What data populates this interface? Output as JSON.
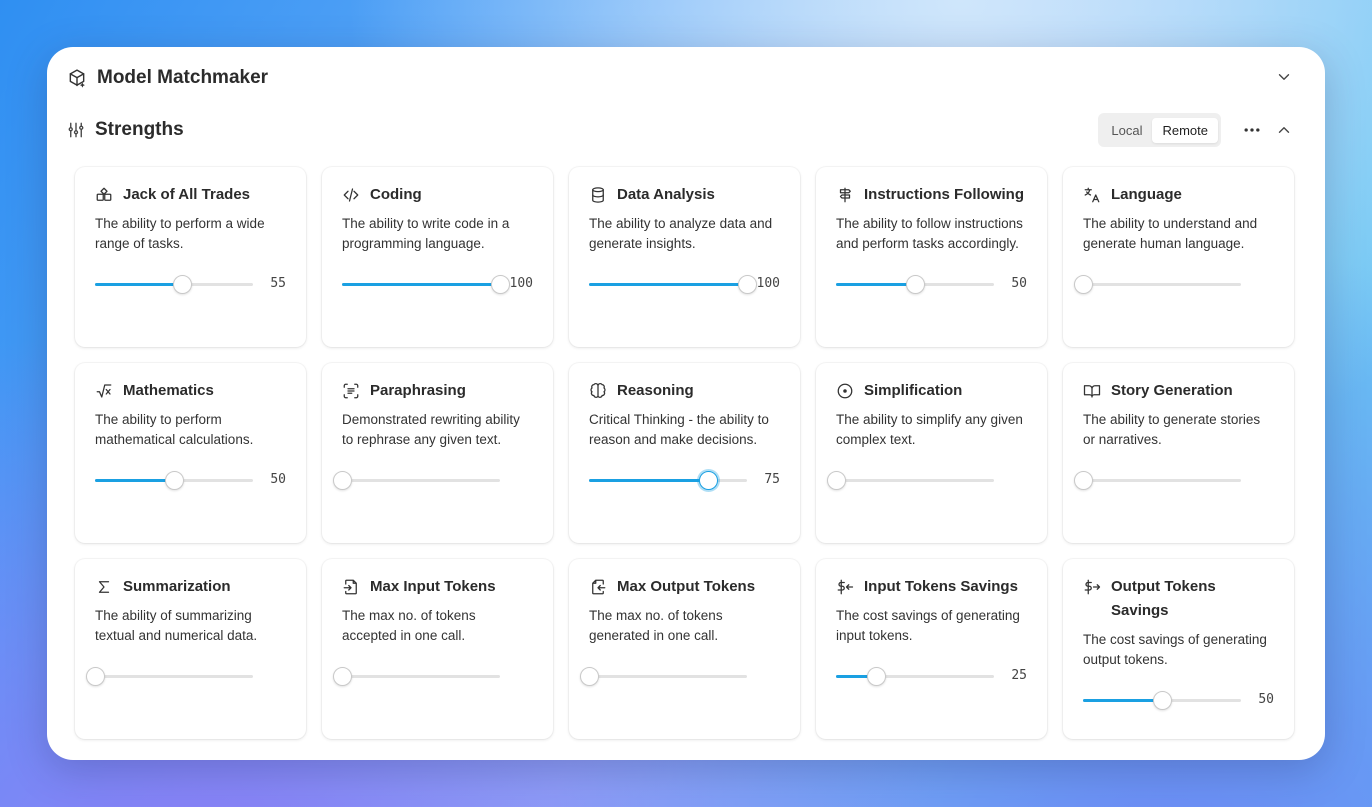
{
  "app": {
    "title": "Model Matchmaker"
  },
  "section": {
    "title": "Strengths",
    "toggle": {
      "local_label": "Local",
      "remote_label": "Remote",
      "active": "Remote"
    }
  },
  "colors": {
    "accent": "#1aa0e2",
    "track": "#e2e2e2"
  },
  "cards": [
    {
      "id": "jack-of-all-trades",
      "name": "Jack of All Trades",
      "icon": "shapes-icon",
      "desc": "The ability to perform a wide range of tasks.",
      "value": 55,
      "value_label": "55"
    },
    {
      "id": "coding",
      "name": "Coding",
      "icon": "code-icon",
      "desc": "The ability to write code in a programming language.",
      "value": 100,
      "value_label": "100"
    },
    {
      "id": "data-analysis",
      "name": "Data Analysis",
      "icon": "database-icon",
      "desc": "The ability to analyze data and generate insights.",
      "value": 100,
      "value_label": "100"
    },
    {
      "id": "instructions-following",
      "name": "Instructions Following",
      "icon": "signpost-icon",
      "desc": "The ability to follow instructions and perform tasks accordingly.",
      "value": 50,
      "value_label": "50"
    },
    {
      "id": "language",
      "name": "Language",
      "icon": "translate-icon",
      "desc": "The ability to understand and generate human language.",
      "value": 0,
      "value_label": ""
    },
    {
      "id": "mathematics",
      "name": "Mathematics",
      "icon": "square-root-icon",
      "desc": "The ability to perform mathematical calculations.",
      "value": 50,
      "value_label": "50"
    },
    {
      "id": "paraphrasing",
      "name": "Paraphrasing",
      "icon": "scan-text-icon",
      "desc": "Demonstrated rewriting ability to rephrase any given text.",
      "value": 0,
      "value_label": ""
    },
    {
      "id": "reasoning",
      "name": "Reasoning",
      "icon": "brain-icon",
      "desc": "Critical Thinking - the ability to reason and make decisions.",
      "value": 75,
      "value_label": "75",
      "focus": true
    },
    {
      "id": "simplification",
      "name": "Simplification",
      "icon": "circle-dot-icon",
      "desc": "The ability to simplify any given complex text.",
      "value": 0,
      "value_label": ""
    },
    {
      "id": "story-generation",
      "name": "Story Generation",
      "icon": "book-open-icon",
      "desc": "The ability to generate stories or narratives.",
      "value": 0,
      "value_label": ""
    },
    {
      "id": "summarization",
      "name": "Summarization",
      "icon": "sigma-icon",
      "desc": "The ability of summarizing textual and numerical data.",
      "value": 0,
      "value_label": ""
    },
    {
      "id": "max-input-tokens",
      "name": "Max Input Tokens",
      "icon": "file-input-icon",
      "desc": "The max no. of tokens accepted in one call.",
      "value": 0,
      "value_label": ""
    },
    {
      "id": "max-output-tokens",
      "name": "Max Output Tokens",
      "icon": "file-output-icon",
      "desc": "The max no. of tokens generated in one call.",
      "value": 0,
      "value_label": ""
    },
    {
      "id": "input-tokens-savings",
      "name": "Input Tokens Savings",
      "icon": "dollar-arrow-left-icon",
      "desc": "The cost savings of generating input tokens.",
      "value": 25,
      "value_label": "25"
    },
    {
      "id": "output-tokens-savings",
      "name": "Output Tokens Savings",
      "icon": "dollar-arrow-right-icon",
      "desc": "The cost savings of generating output tokens.",
      "value": 50,
      "value_label": "50"
    }
  ]
}
